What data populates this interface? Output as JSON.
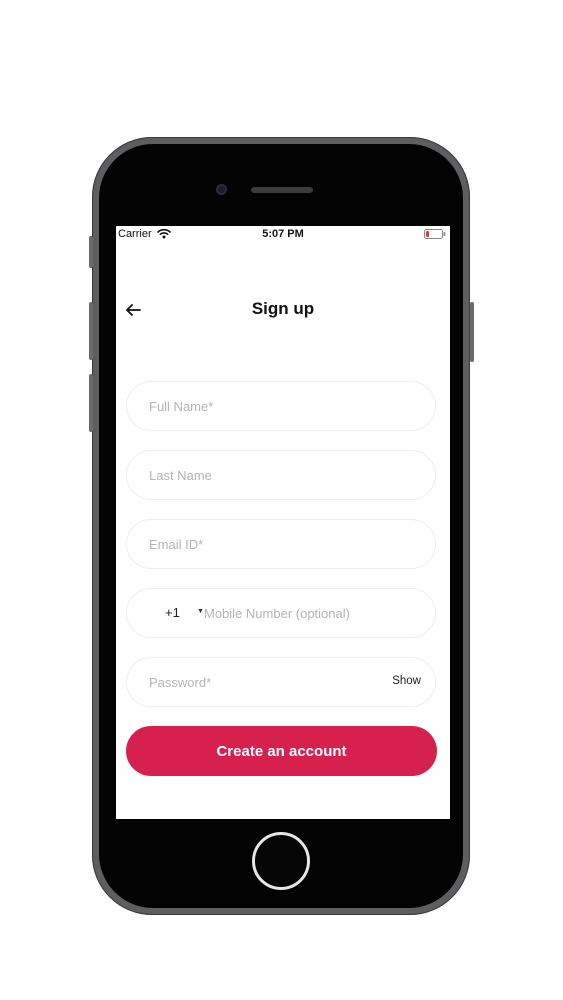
{
  "status_bar": {
    "carrier": "Carrier",
    "time": "5:07 PM",
    "battery_color": "#e53935"
  },
  "header": {
    "back_icon": "arrow-left-icon",
    "title": "Sign up"
  },
  "form": {
    "full_name": {
      "placeholder": "Full Name*",
      "value": ""
    },
    "last_name": {
      "placeholder": "Last Name",
      "value": ""
    },
    "email": {
      "placeholder": "Email ID*",
      "value": ""
    },
    "mobile": {
      "country_code": "+1",
      "placeholder": "Mobile Number (optional)",
      "value": ""
    },
    "password": {
      "placeholder": "Password*",
      "value": "",
      "toggle_label": "Show"
    },
    "submit_label": "Create an account"
  },
  "colors": {
    "accent": "#d6214f",
    "field_border": "#eeeeee",
    "placeholder": "#b4b4b4"
  }
}
